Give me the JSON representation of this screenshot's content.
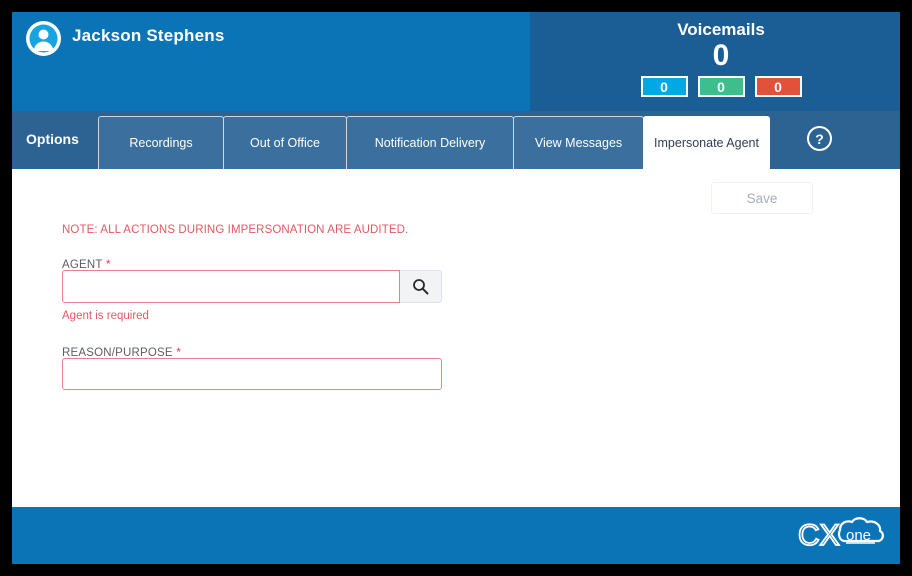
{
  "header": {
    "avatar_icon": "user-avatar-icon",
    "user_name": "Jackson Stephens",
    "voicemails": {
      "title": "Voicemails",
      "total": "0",
      "badges": [
        {
          "value": "0",
          "color": "#00a9e6"
        },
        {
          "value": "0",
          "color": "#3cbf8d"
        },
        {
          "value": "0",
          "color": "#e2513c"
        }
      ]
    },
    "bg_left": "#0b74b6",
    "bg_right": "#1b5e96"
  },
  "tabbar": {
    "options_label": "Options",
    "help_icon": "question-mark-circle-icon",
    "tabs": [
      {
        "label": "Recordings",
        "active": false,
        "width": 126
      },
      {
        "label": "Out of Office",
        "active": false,
        "width": 124
      },
      {
        "label": "Notification Delivery",
        "active": false,
        "width": 168
      },
      {
        "label": "View Messages",
        "active": false,
        "width": 131
      },
      {
        "label": "Impersonate Agent",
        "active": true,
        "width": 127
      }
    ]
  },
  "content": {
    "save_label": "Save",
    "audit_note": "NOTE: ALL ACTIONS DURING IMPERSONATION ARE AUDITED.",
    "agent": {
      "label": "AGENT",
      "required_marker": "*",
      "value": "",
      "placeholder": "",
      "search_icon": "search-icon",
      "error": "Agent is required"
    },
    "reason": {
      "label": "REASON/PURPOSE",
      "required_marker": "*",
      "value": "",
      "placeholder": ""
    }
  },
  "footer": {
    "logo_text_primary": "CX",
    "logo_text_secondary": "one",
    "bg": "#0b74b6"
  }
}
